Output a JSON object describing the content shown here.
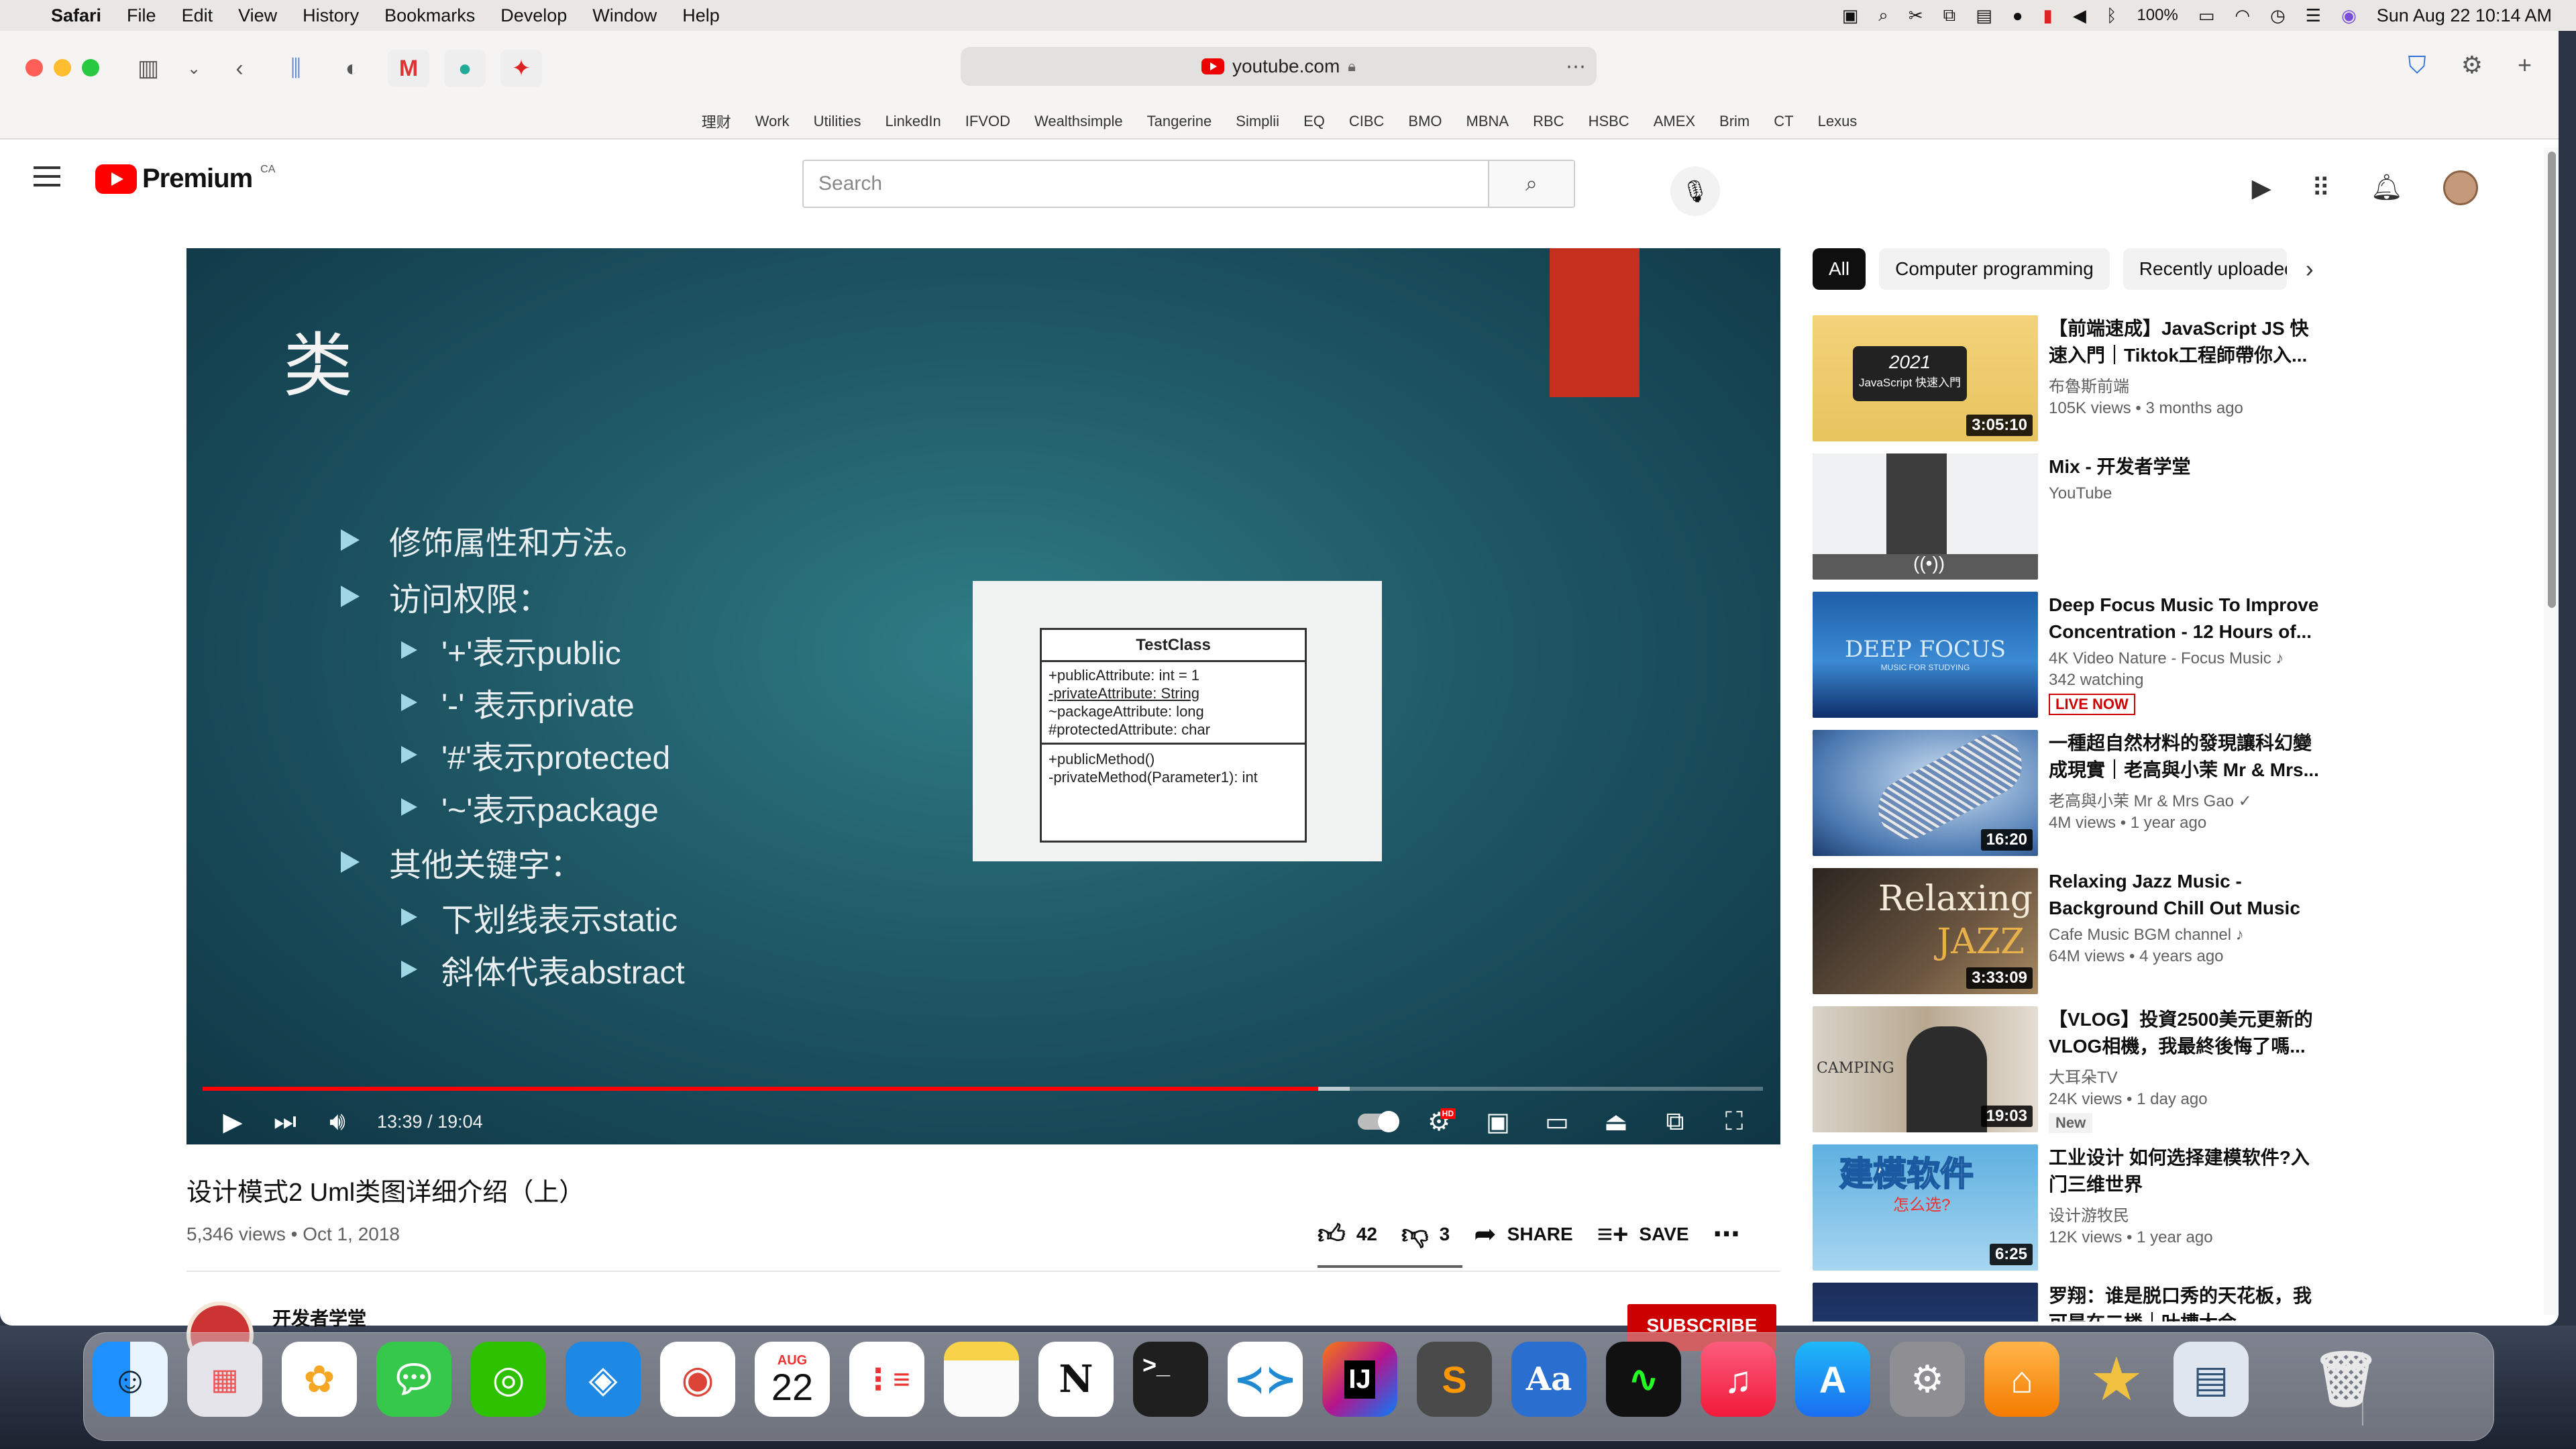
{
  "menubar": {
    "app_name": "Safari",
    "items": [
      "File",
      "Edit",
      "View",
      "History",
      "Bookmarks",
      "Develop",
      "Window",
      "Help"
    ],
    "battery": "100%",
    "datetime": "Sun Aug 22  10:14 AM"
  },
  "browser": {
    "url": "youtube.com",
    "favorites": [
      "理财",
      "Work",
      "Utilities",
      "LinkedIn",
      "IFVOD",
      "Wealthsimple",
      "Tangerine",
      "Simplii",
      "EQ",
      "CIBC",
      "BMO",
      "MBNA",
      "RBC",
      "HSBC",
      "AMEX",
      "Brim",
      "CT",
      "Lexus"
    ]
  },
  "youtube": {
    "logo_word": "Premium",
    "region": "CA",
    "search_placeholder": "Search"
  },
  "slide": {
    "title": "类",
    "bullets": [
      {
        "text": "修饰属性和方法。",
        "level": 1
      },
      {
        "text": "访问权限：",
        "level": 1
      },
      {
        "text": "'+'表示public",
        "level": 2
      },
      {
        "text": "'-' 表示private",
        "level": 2
      },
      {
        "text": "'#'表示protected",
        "level": 2
      },
      {
        "text": "'~'表示package",
        "level": 2
      },
      {
        "text": "其他关键字：",
        "level": 1
      },
      {
        "text": "下划线表示static",
        "level": 2
      },
      {
        "text": "斜体代表abstract",
        "level": 2
      }
    ],
    "uml": {
      "class_name": "TestClass",
      "attributes": [
        "+publicAttribute: int = 1",
        "-privateAttribute: String",
        "~packageAttribute: long",
        "#protectedAttribute: char"
      ],
      "methods": [
        "+publicMethod()",
        "-privateMethod(Parameter1): int"
      ]
    }
  },
  "player": {
    "time": "13:39 / 19:04",
    "progress_fraction": 0.715,
    "hd_badge": "HD"
  },
  "video": {
    "title": "设计模式2 Uml类图详细介绍（上）",
    "meta": "5,346 views • Oct 1, 2018",
    "likes": "42",
    "dislikes": "3",
    "share": "SHARE",
    "save": "SAVE",
    "channel": "开发者学堂",
    "subscribe": "SUBSCRIBE"
  },
  "chips": [
    "All",
    "Computer programming",
    "Recently uploaded"
  ],
  "recommendations": [
    {
      "title": "【前端速成】JavaScript JS 快速入門｜Tiktok工程師帶你入...",
      "channel": "布魯斯前端",
      "stats": "105K views • 3 months ago",
      "duration": "3:05:10",
      "thumb_text": "2021",
      "thumb_text2": "JavaScript 快速入門"
    },
    {
      "title": "Mix - 开发者学堂",
      "channel": "YouTube",
      "stats": "",
      "duration": ""
    },
    {
      "title": "Deep Focus Music To Improve Concentration - 12 Hours of...",
      "channel": "4K Video Nature - Focus Music ♪",
      "stats": "342 watching",
      "duration": "",
      "live": "LIVE NOW",
      "thumb_text": "DEEP FOCUS",
      "thumb_text2": "MUSIC FOR STUDYING"
    },
    {
      "title": "一種超自然材料的發現讓科幻變成現實｜老高與小茉 Mr & Mrs...",
      "channel": "老高與小茉 Mr & Mrs Gao ✓",
      "stats": "4M views • 1 year ago",
      "duration": "16:20"
    },
    {
      "title": "Relaxing Jazz Music - Background Chill Out Music -...",
      "channel": "Cafe Music BGM channel ♪",
      "stats": "64M views • 4 years ago",
      "duration": "3:33:09",
      "thumb_text": "Relaxing",
      "thumb_text2": "JAZZ"
    },
    {
      "title": "【VLOG】投資2500美元更新的VLOG相機，我最終後悔了嗎...",
      "channel": "大耳朵TV",
      "stats": "24K views • 1 day ago",
      "duration": "19:03",
      "new": "New",
      "thumb_text": "CAMPING"
    },
    {
      "title": "工业设计 如何选择建模软件?入门三维世界",
      "channel": "设计游牧民",
      "stats": "12K views • 1 year ago",
      "duration": "6:25",
      "thumb_text": "建模软件",
      "thumb_text2": "怎么选?"
    },
    {
      "title": "罗翔：谁是脱口秀的天花板，我可是在二楼｜叶槽大会",
      "channel": "",
      "stats": "",
      "duration": ""
    }
  ],
  "dock": {
    "calendar_month": "AUG",
    "calendar_day": "22",
    "terminal_prompt": ">_",
    "intellij": "IJ"
  },
  "colors": {
    "youtube_red": "#FF0000",
    "slide_bg": "#1f5866",
    "accent_bar": "#c42f1e",
    "live_red": "#CC0000"
  }
}
